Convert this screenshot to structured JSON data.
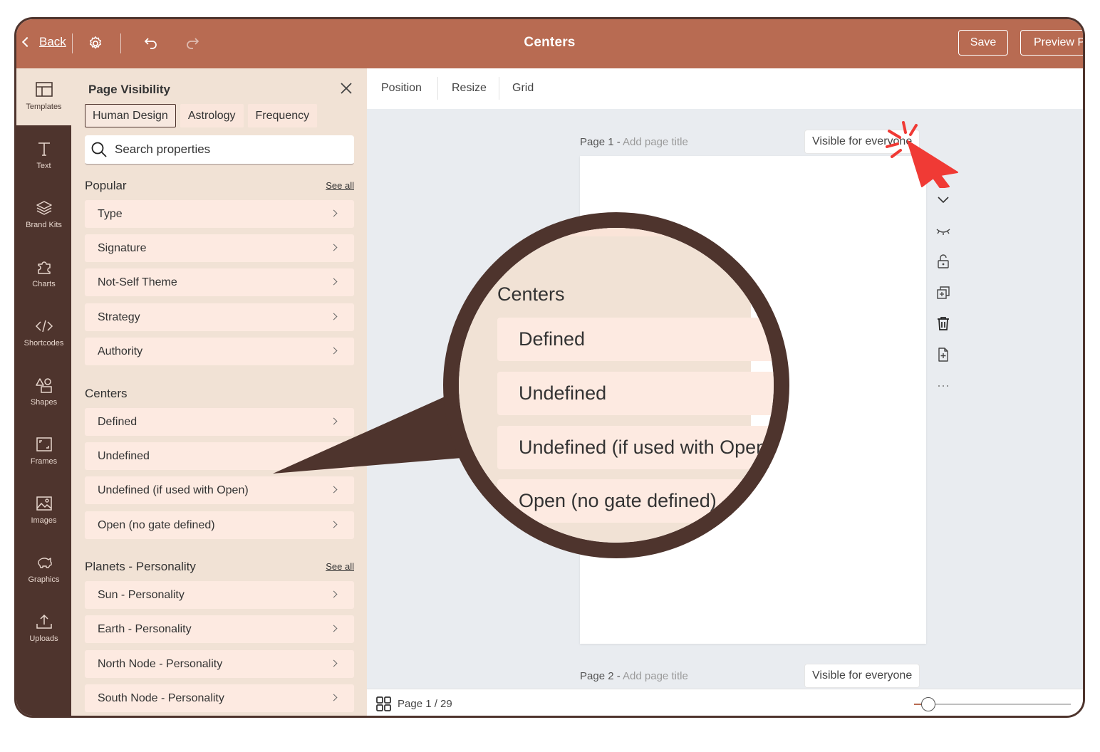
{
  "header": {
    "back_label": "Back",
    "title": "Centers",
    "save_label": "Save",
    "preview_label": "Preview P"
  },
  "rail": {
    "items": [
      {
        "label": "Templates",
        "icon": "layout-icon",
        "active": true
      },
      {
        "label": "Text",
        "icon": "text-icon"
      },
      {
        "label": "Brand Kits",
        "icon": "layers-icon"
      },
      {
        "label": "Charts",
        "icon": "puzzle-icon"
      },
      {
        "label": "Shortcodes",
        "icon": "code-icon"
      },
      {
        "label": "Shapes",
        "icon": "shapes-icon"
      },
      {
        "label": "Frames",
        "icon": "frame-icon"
      },
      {
        "label": "Images",
        "icon": "image-icon"
      },
      {
        "label": "Graphics",
        "icon": "piggy-icon"
      },
      {
        "label": "Uploads",
        "icon": "upload-icon"
      }
    ]
  },
  "panel": {
    "title": "Page Visibility",
    "tabs": [
      "Human Design",
      "Astrology",
      "Frequency"
    ],
    "active_tab": "Human Design",
    "search_placeholder": "Search properties",
    "sections": [
      {
        "heading": "Popular",
        "see_all": "See all",
        "items": [
          "Type",
          "Signature",
          "Not-Self Theme",
          "Strategy",
          "Authority"
        ]
      },
      {
        "heading": "Centers",
        "see_all": "",
        "items": [
          "Defined",
          "Undefined",
          "Undefined (if used with Open)",
          "Open (no gate defined)"
        ]
      },
      {
        "heading": "Planets - Personality",
        "see_all": "See all",
        "items": [
          "Sun - Personality",
          "Earth - Personality",
          "North Node - Personality",
          "South Node - Personality"
        ]
      }
    ]
  },
  "canvas_toolbar": {
    "position": "Position",
    "resize": "Resize",
    "grid": "Grid"
  },
  "pages": [
    {
      "label": "Page 1 - ",
      "title_placeholder": "Add page title",
      "visibility": "Visible for everyone"
    },
    {
      "label": "Page 2 - ",
      "title_placeholder": "Add page title",
      "visibility": "Visible for everyone"
    }
  ],
  "footer": {
    "page_counter": "Page 1 / 29",
    "zoom_level": 0.09
  },
  "magnifier": {
    "heading": "Centers",
    "items": [
      "Defined",
      "Undefined",
      "Undefined (if used with Open)",
      "Open (no gate defined)"
    ]
  },
  "colors": {
    "brand": "#b86b52",
    "dark": "#4e342d",
    "panel": "#f1e2d5",
    "item": "#fdeae1",
    "cursor": "#f03a35"
  }
}
